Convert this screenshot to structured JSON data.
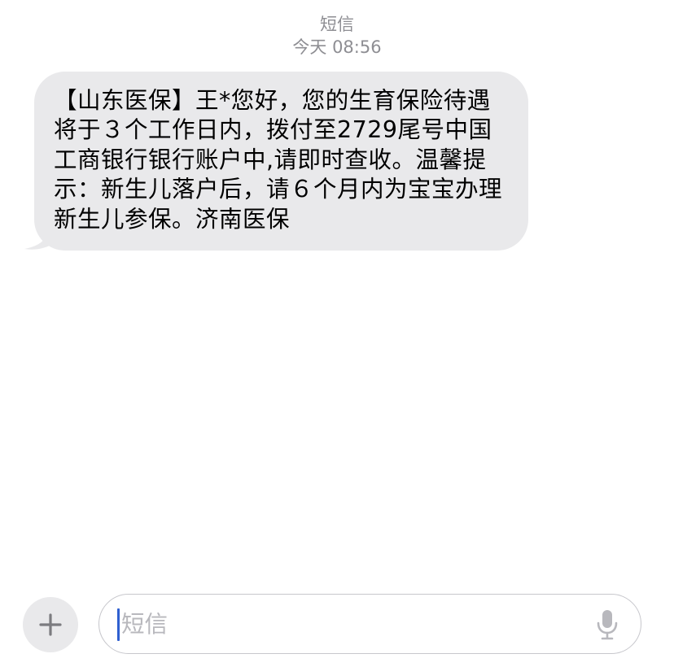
{
  "header": {
    "service_name": "短信",
    "timestamp": "今天 08:56"
  },
  "message": {
    "text": "【山东医保】王*您好，您的生育保险待遇将于３个工作日内，拨付至2729尾号中国工商银行银行账户中,请即时查收。温馨提示：新生儿落户后，请６个月内为宝宝办理新生儿参保。济南医保"
  },
  "composer": {
    "placeholder": "短信",
    "plus_icon": "plus-icon",
    "mic_icon": "microphone-icon"
  },
  "colors": {
    "bubble_background": "#e9e9eb",
    "header_text": "#8e8e93",
    "cursor": "#2f5fd0"
  }
}
